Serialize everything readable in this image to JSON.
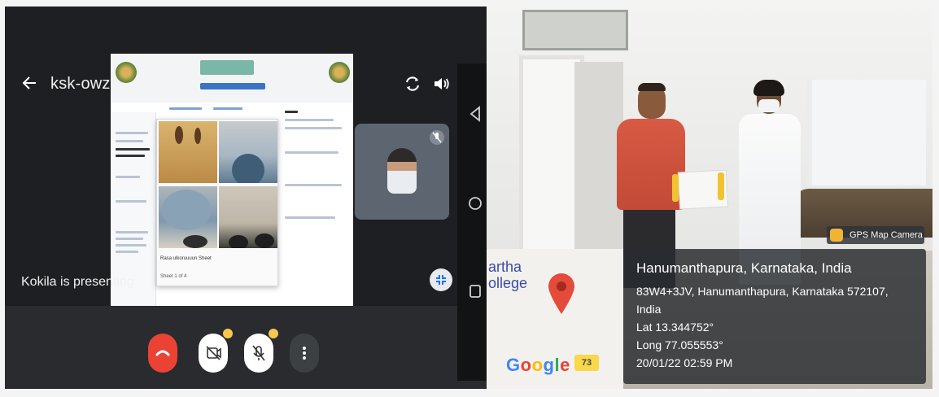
{
  "call": {
    "meeting_code": "ksk-owzu-tzi",
    "presenter_status": "Kokila is presenting",
    "shared_caption": "Rasa ulkoruuuun Sheet",
    "shared_caption2": "Sheet 1 of 4"
  },
  "photo": {
    "gps_app_label": "GPS Map Camera",
    "location_title": "Hanumanthapura, Karnataka, India",
    "address_line": "83W4+3JV, Hanumanthapura, Karnataka 572107,",
    "country": "India",
    "lat": "Lat 13.344752°",
    "long": "Long 77.055553°",
    "datetime": "20/01/22 02:59 PM",
    "map_place_line1": "artha",
    "map_place_line2": "ollege",
    "map_road_number": "73",
    "map_logo": "Google"
  },
  "colors": {
    "end_call": "#ea4335",
    "notification_dot": "#f9c74f",
    "map_pin": "#e54b3b"
  },
  "icons": [
    "back-arrow-icon",
    "camera-rotate-icon",
    "speaker-icon",
    "mic-off-icon",
    "minimize-icon",
    "end-call-icon",
    "camera-off-icon",
    "more-options-icon",
    "nav-back-icon",
    "nav-home-icon",
    "nav-recent-icon",
    "map-pin-icon",
    "gps-camera-icon"
  ]
}
